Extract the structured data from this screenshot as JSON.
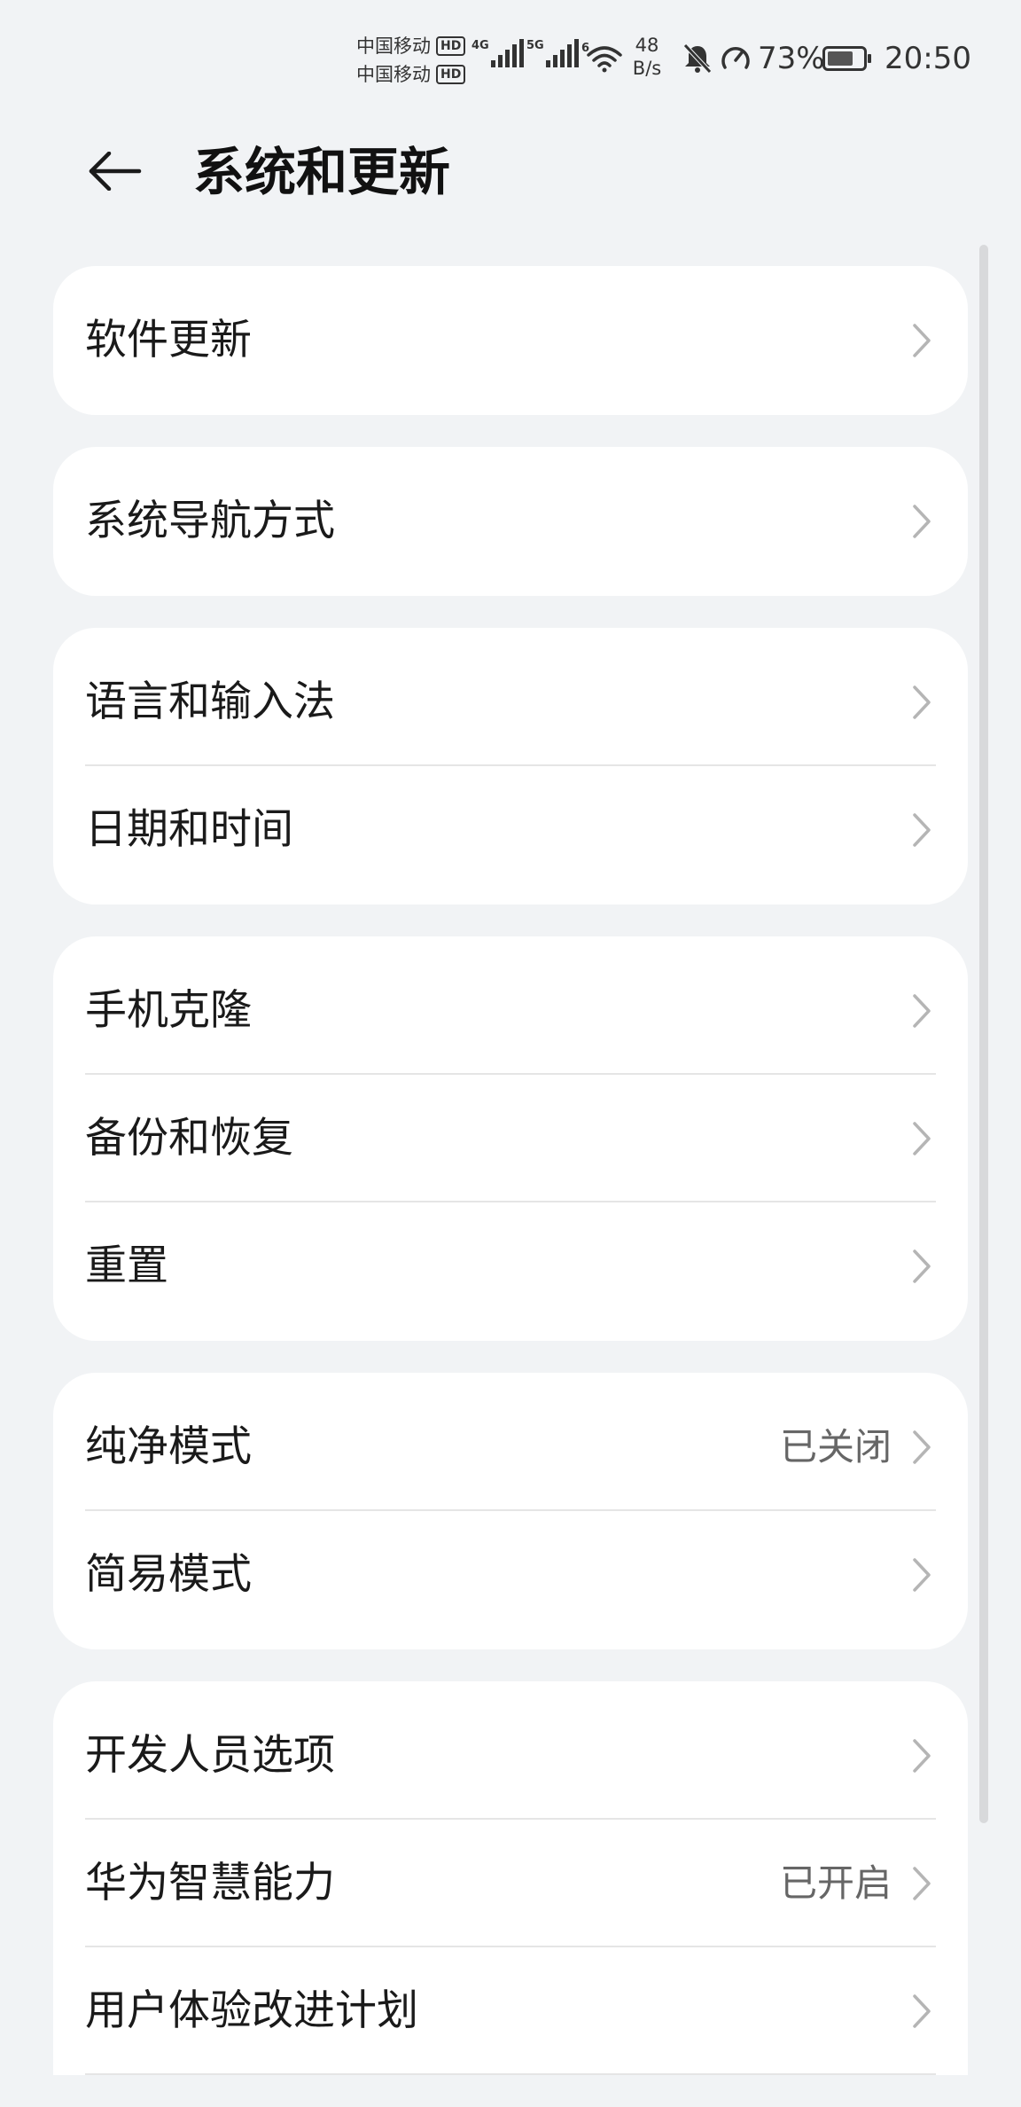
{
  "status_bar": {
    "carrier_1": "中国移动",
    "carrier_2": "中国移动",
    "hd_badge": "HD",
    "network_1": "4G",
    "network_2": "5G",
    "wifi_label": "6",
    "speed_value": "48",
    "speed_unit": "B/s",
    "battery_percent": "73%",
    "battery_level": 0.73,
    "time": "20:50"
  },
  "header": {
    "back_icon": "arrow-left-icon",
    "title": "系统和更新"
  },
  "cards": [
    {
      "items": [
        {
          "label": "软件更新",
          "value": ""
        }
      ]
    },
    {
      "items": [
        {
          "label": "系统导航方式",
          "value": ""
        }
      ]
    },
    {
      "items": [
        {
          "label": "语言和输入法",
          "value": ""
        },
        {
          "label": "日期和时间",
          "value": ""
        }
      ]
    },
    {
      "items": [
        {
          "label": "手机克隆",
          "value": ""
        },
        {
          "label": "备份和恢复",
          "value": ""
        },
        {
          "label": "重置",
          "value": ""
        }
      ]
    },
    {
      "items": [
        {
          "label": "纯净模式",
          "value": "已关闭"
        },
        {
          "label": "简易模式",
          "value": ""
        }
      ]
    },
    {
      "items": [
        {
          "label": "开发人员选项",
          "value": ""
        },
        {
          "label": "华为智慧能力",
          "value": "已开启"
        },
        {
          "label": "用户体验改进计划",
          "value": ""
        }
      ]
    }
  ],
  "colors": {
    "background": "#f1f3f5",
    "card": "#ffffff",
    "chevron": "#b5b5b5"
  }
}
